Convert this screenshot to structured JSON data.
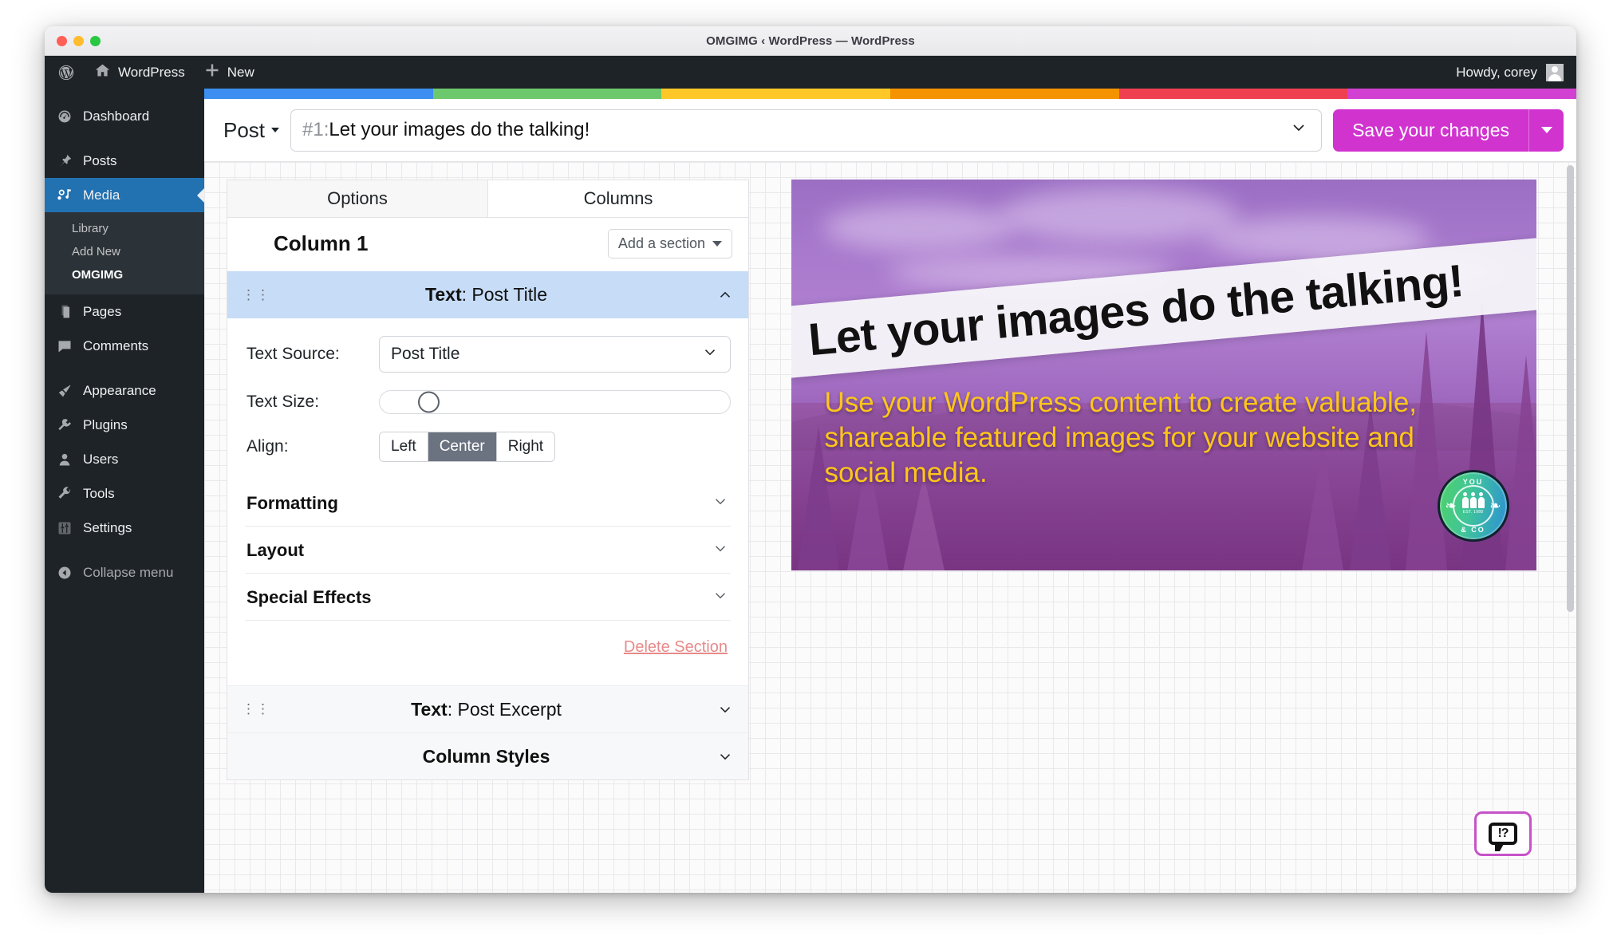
{
  "window": {
    "title": "OMGIMG ‹ WordPress — WordPress"
  },
  "adminbar": {
    "wp_logo_icon": "wordpress-logo-icon",
    "site_icon": "home-icon",
    "site_label": "WordPress",
    "new_icon": "plus-icon",
    "new_label": "New",
    "howdy": "Howdy, corey",
    "avatar_icon": "avatar-icon"
  },
  "sidebar": {
    "items": [
      {
        "label": "Dashboard",
        "icon": "dashboard-icon",
        "current": false
      },
      {
        "label": "Posts",
        "icon": "pin-icon",
        "current": false
      },
      {
        "label": "Media",
        "icon": "media-icon",
        "current": true
      },
      {
        "label": "Pages",
        "icon": "pages-icon",
        "current": false
      },
      {
        "label": "Comments",
        "icon": "comment-icon",
        "current": false
      },
      {
        "label": "Appearance",
        "icon": "brush-icon",
        "current": false
      },
      {
        "label": "Plugins",
        "icon": "plug-icon",
        "current": false
      },
      {
        "label": "Users",
        "icon": "user-icon",
        "current": false
      },
      {
        "label": "Tools",
        "icon": "wrench-icon",
        "current": false
      },
      {
        "label": "Settings",
        "icon": "sliders-icon",
        "current": false
      }
    ],
    "submenu": [
      {
        "label": "Library",
        "current": false
      },
      {
        "label": "Add New",
        "current": false
      },
      {
        "label": "OMGIMG",
        "current": true
      }
    ],
    "collapse": {
      "label": "Collapse menu",
      "icon": "collapse-arrow-icon"
    }
  },
  "stripe_colors": [
    "#3c8ef0",
    "#6cc86c",
    "#ffc828",
    "#f59200",
    "#ef4050",
    "#d240d2"
  ],
  "toolbar": {
    "post_type_label": "Post",
    "post_type_caret_icon": "caret-down-icon",
    "title_number": "#1:",
    "title_text": " Let your images do the talking!",
    "title_chevron_icon": "chevron-down-icon",
    "save_label": "Save your changes",
    "save_caret_icon": "caret-down-icon",
    "save_color": "#d133cf"
  },
  "panel": {
    "tabs": [
      {
        "label": "Options",
        "active": true
      },
      {
        "label": "Columns",
        "active": false
      }
    ],
    "column_title": "Column 1",
    "add_section_label": "Add a section",
    "add_section_caret_icon": "caret-down-icon",
    "sections": [
      {
        "name_bold": "Text",
        "name_rest": ": Post Title",
        "open": true,
        "grip_icon": "drag-handle-icon",
        "chevron_icon": "chevron-up-icon"
      },
      {
        "name_bold": "Text",
        "name_rest": ": Post Excerpt",
        "open": false,
        "grip_icon": "drag-handle-icon",
        "chevron_icon": "chevron-down-icon"
      }
    ],
    "column_styles_label": "Column Styles",
    "column_styles_chevron_icon": "chevron-down-icon",
    "controls": {
      "text_source_label": "Text Source:",
      "text_source_value": "Post Title",
      "text_source_chevron_icon": "chevron-down-icon",
      "text_size_label": "Text Size:",
      "align_label": "Align:",
      "align_options": [
        "Left",
        "Center",
        "Right"
      ],
      "align_selected": "Center"
    },
    "accordions": [
      {
        "label": "Formatting",
        "chevron_icon": "chevron-down-icon"
      },
      {
        "label": "Layout",
        "chevron_icon": "chevron-down-icon"
      },
      {
        "label": "Special Effects",
        "chevron_icon": "chevron-down-icon"
      }
    ],
    "delete_label": "Delete Section"
  },
  "preview": {
    "title_overlay": "Let your images do the talking!",
    "excerpt_overlay": "Use your WordPress content to create valuable, shareable featured images for your website and social media.",
    "excerpt_color": "#ffc61a",
    "badge": {
      "top_word": "YOU",
      "bottom_word": "& CO",
      "est": "EST. 1988",
      "icon": "group-badge-icon"
    }
  },
  "feedback": {
    "icon": "feedback-bubble-icon",
    "glyph": "!?",
    "border_color": "#c653c8"
  }
}
